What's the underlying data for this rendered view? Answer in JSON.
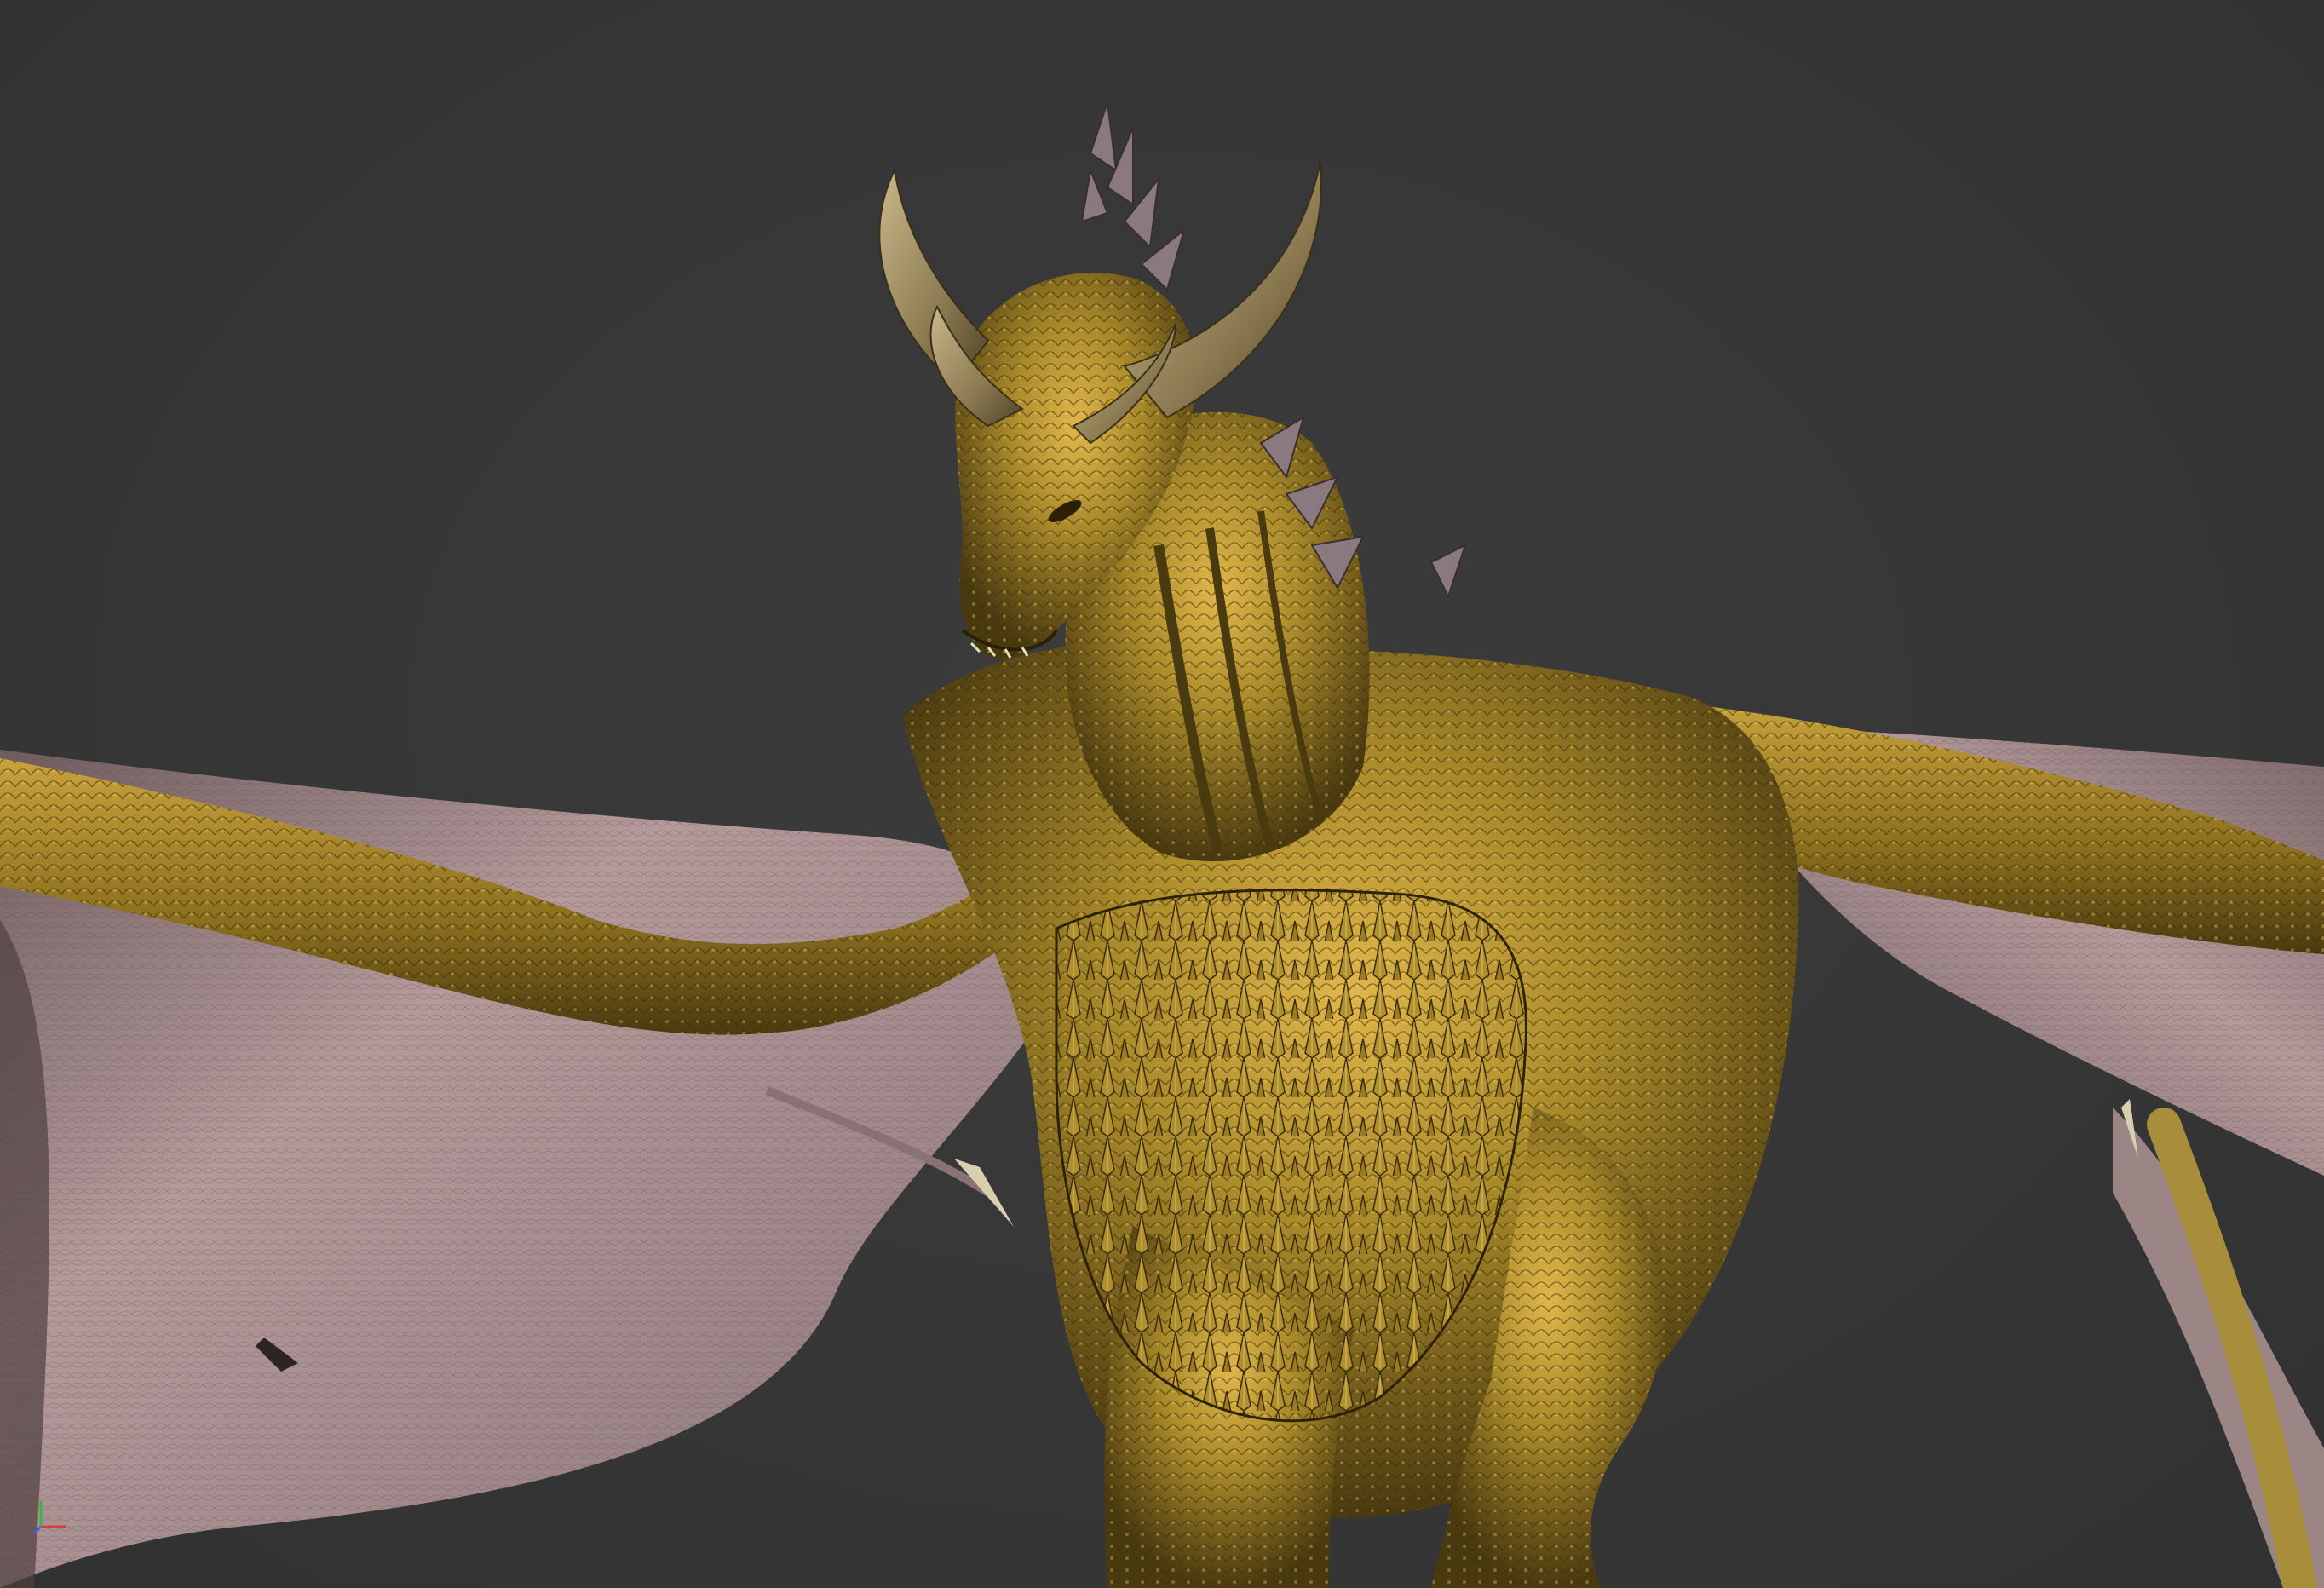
{
  "viewport": {
    "background_color": "#373737",
    "mode": "3d-perspective"
  },
  "subject": {
    "kind": "dragon-3d-model",
    "body_color": "#a98a2a",
    "highlight_color": "#e0b64a",
    "shadow_color": "#4a3a10",
    "wing_membrane_color": "#b59a9a",
    "wing_membrane_shadow": "#6e5c5e",
    "horn_color": "#8c7a52"
  },
  "gizmo": {
    "icon": "axis-gizmo-icon",
    "x_axis_color": "#d93a3a",
    "y_axis_color": "#3ab54a",
    "z_axis_color": "#3a6ad9"
  }
}
